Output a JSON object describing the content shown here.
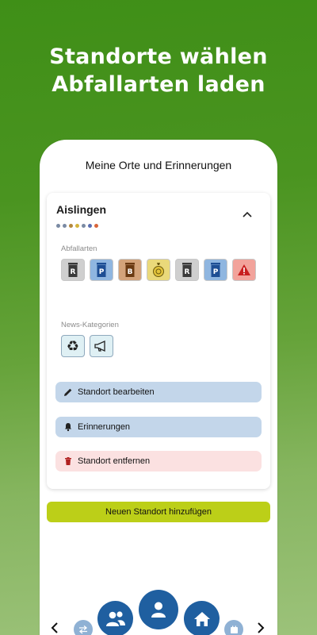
{
  "headline": {
    "line1": "Standorte wählen",
    "line2": "Abfallarten laden"
  },
  "app": {
    "title": "Meine Orte und Erinnerungen"
  },
  "location": {
    "name": "Aislingen",
    "dot_colors": [
      "#7a8aa3",
      "#7a8aa3",
      "#b5883c",
      "#d4b43c",
      "#7a8aa3",
      "#5b6fb3",
      "#d9653b"
    ]
  },
  "waste_types": {
    "label": "Abfallarten",
    "items": [
      {
        "icon": "restmuell-bin-icon",
        "letter": "R",
        "bg": "#cfcfcf"
      },
      {
        "icon": "papier-bin-icon",
        "letter": "P",
        "bg": "#8fb6e0"
      },
      {
        "icon": "bio-bin-icon",
        "letter": "B",
        "bg": "#d4a37a"
      },
      {
        "icon": "gelber-sack-icon",
        "letter": "",
        "bg": "#ead97a"
      },
      {
        "icon": "restmuell-large-bin-icon",
        "letter": "R",
        "bg": "#cfcfcf"
      },
      {
        "icon": "papier-large-bin-icon",
        "letter": "P",
        "bg": "#8fb6e0"
      },
      {
        "icon": "warning-icon",
        "letter": "!",
        "bg": "#f2a39b"
      }
    ]
  },
  "news_categories": {
    "label": "News-Kategorien",
    "items": [
      {
        "icon": "recycle-icon",
        "bg": "#dff0f4"
      },
      {
        "icon": "megaphone-icon",
        "bg": "#dff0f4"
      }
    ]
  },
  "actions": {
    "edit_label": "Standort bearbeiten",
    "reminders_label": "Erinnerungen",
    "remove_label": "Standort entfernen"
  },
  "add_location_label": "Neuen Standort hinzufügen",
  "colors": {
    "action_blue": "#c3d6ea",
    "action_red": "#fbe1e1",
    "nav_blue": "#1f5fa0",
    "accent_lime": "#bccf18"
  }
}
